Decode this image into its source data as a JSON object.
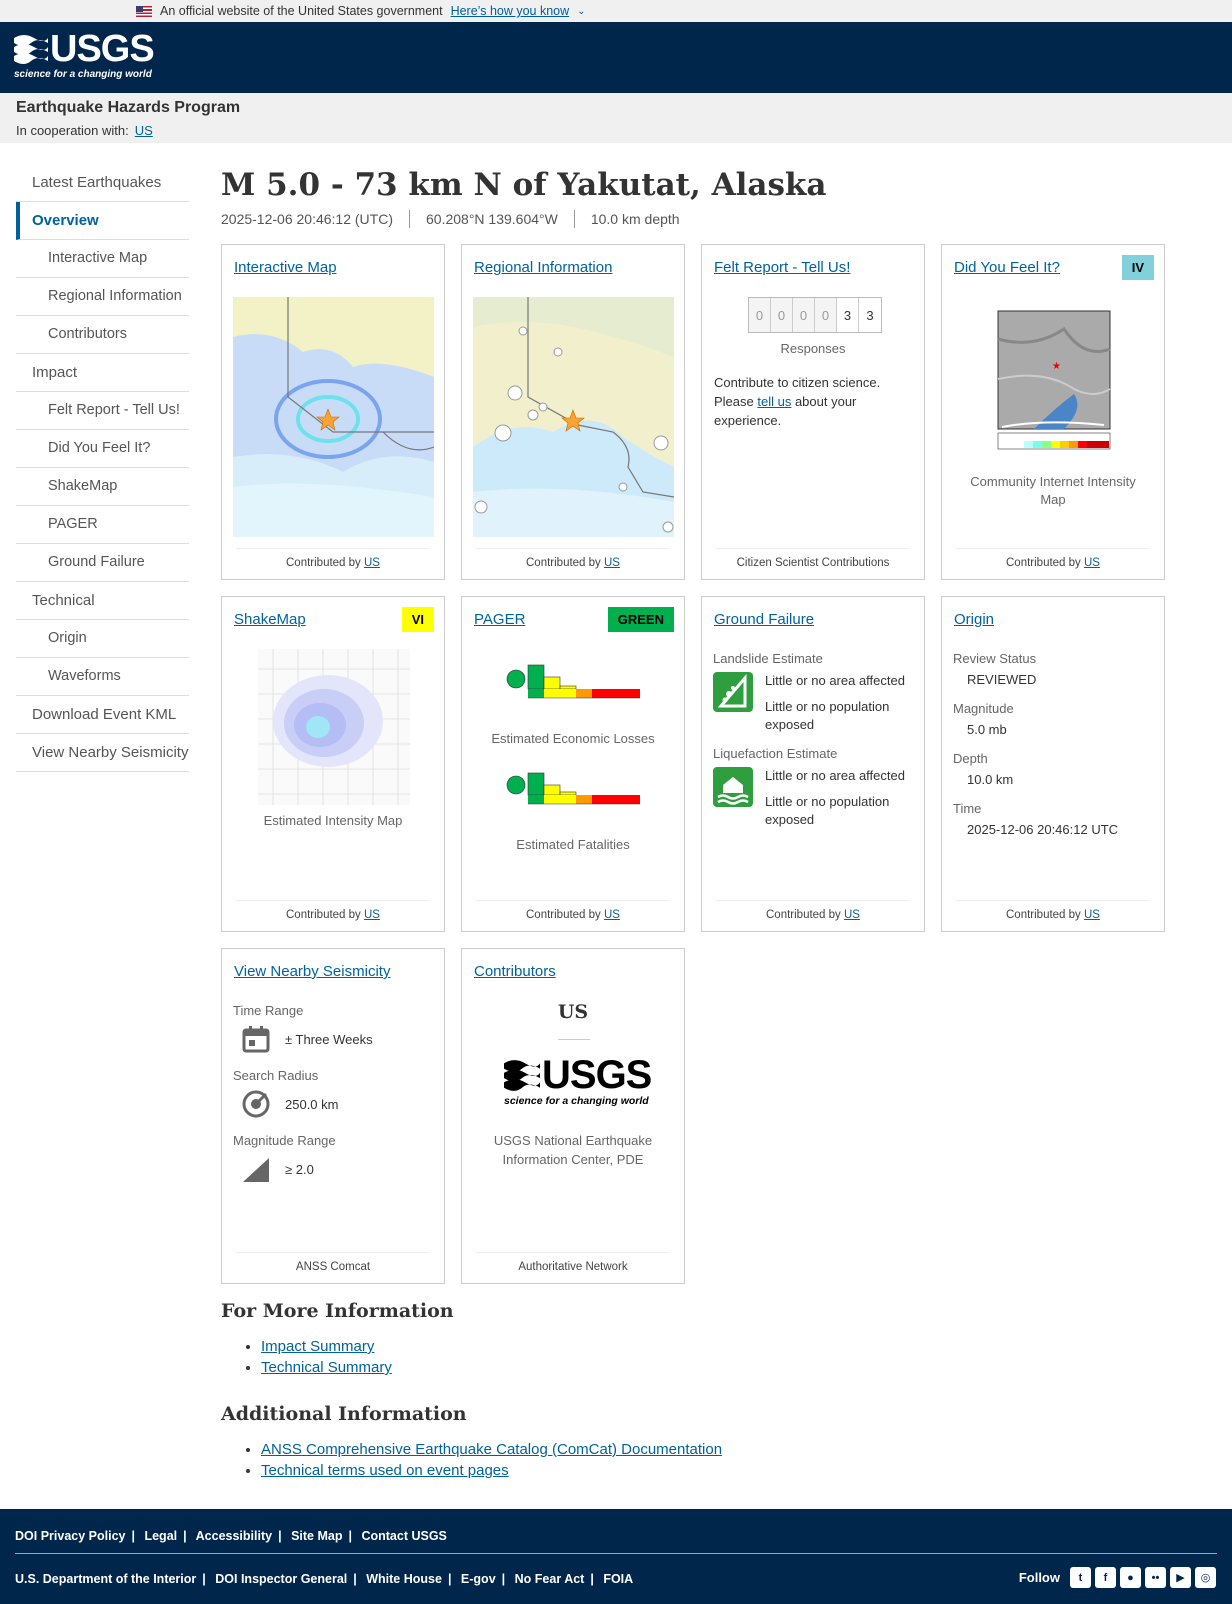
{
  "gov_banner": {
    "text": "An official website of the United States government",
    "link": "Here’s how you know"
  },
  "header": {
    "logo_word": "USGS",
    "logo_tagline": "science for a changing world"
  },
  "program": {
    "title": "Earthquake Hazards Program",
    "coop_label": "In cooperation with:",
    "coop_link": "US"
  },
  "sidebar": {
    "items": [
      "Latest Earthquakes",
      "Overview",
      "Interactive Map",
      "Regional Information",
      "Contributors",
      "Impact",
      "Felt Report - Tell Us!",
      "Did You Feel It?",
      "ShakeMap",
      "PAGER",
      "Ground Failure",
      "Technical",
      "Origin",
      "Waveforms",
      "Download Event KML",
      "View Nearby Seismicity"
    ]
  },
  "event": {
    "title": "M 5.0 - 73 km N of Yakutat, Alaska",
    "time": "2025-12-06 20:46:12 (UTC)",
    "location": "60.208°N 139.604°W",
    "depth": "10.0 km depth"
  },
  "cards": {
    "contrib_prefix": "Contributed by",
    "contrib_link": "US",
    "interactive_map": {
      "title": "Interactive Map"
    },
    "regional": {
      "title": "Regional Information"
    },
    "felt": {
      "title": "Felt Report - Tell Us!",
      "digits": [
        "0",
        "0",
        "0",
        "0",
        "3",
        "3"
      ],
      "responses_label": "Responses",
      "text_before": "Contribute to citizen science. Please ",
      "link": "tell us",
      "text_after": " about your experience.",
      "footer": "Citizen Scientist Contributions"
    },
    "dyfi": {
      "title": "Did You Feel It?",
      "badge": "IV",
      "badge_color": "#82d0dc",
      "caption": "Community Internet Intensity Map"
    },
    "shakemap": {
      "title": "ShakeMap",
      "badge": "VI",
      "badge_color": "#ffff00",
      "caption": "Estimated Intensity Map"
    },
    "pager": {
      "title": "PAGER",
      "badge": "GREEN",
      "badge_color": "#00b04f",
      "econ_caption": "Estimated Economic Losses",
      "fatal_caption": "Estimated Fatalities"
    },
    "ground_failure": {
      "title": "Ground Failure",
      "landslide_label": "Landslide Estimate",
      "liquefaction_label": "Liquefaction Estimate",
      "area_text": "Little or no area affected",
      "pop_text": "Little or no population exposed"
    },
    "origin": {
      "title": "Origin",
      "review_label": "Review Status",
      "review_value": "REVIEWED",
      "mag_label": "Magnitude",
      "mag_value": "5.0 mb",
      "depth_label": "Depth",
      "depth_value": "10.0 km",
      "time_label": "Time",
      "time_value": "2025-12-06 20:46:12 UTC"
    },
    "nearby": {
      "title": "View Nearby Seismicity",
      "time_label": "Time Range",
      "time_value": "± Three Weeks",
      "radius_label": "Search Radius",
      "radius_value": "250.0 km",
      "mag_label": "Magnitude Range",
      "mag_value": "≥ 2.0",
      "footer": "ANSS Comcat"
    },
    "contributors": {
      "title": "Contributors",
      "network": "US",
      "logo_word": "USGS",
      "logo_tagline": "science for a changing world",
      "name": "USGS National Earthquake Information Center, PDE",
      "footer": "Authoritative Network"
    }
  },
  "more_info": {
    "heading": "For More Information",
    "links": [
      "Impact Summary",
      "Technical Summary"
    ]
  },
  "additional": {
    "heading": "Additional Information",
    "links": [
      "ANSS Comprehensive Earthquake Catalog (ComCat) Documentation",
      "Technical terms used on event pages"
    ]
  },
  "footer": {
    "row1": [
      "DOI Privacy Policy",
      "Legal",
      "Accessibility",
      "Site Map",
      "Contact USGS"
    ],
    "row2": [
      "U.S. Department of the Interior",
      "DOI Inspector General",
      "White House",
      "E-gov",
      "No Fear Act",
      "FOIA"
    ],
    "follow": "Follow",
    "social": [
      "twitter-icon",
      "facebook-icon",
      "github-icon",
      "flickr-icon",
      "youtube-icon",
      "instagram-icon"
    ]
  }
}
